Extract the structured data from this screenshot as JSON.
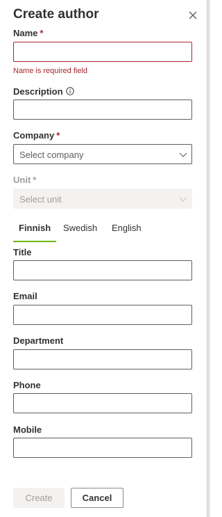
{
  "panel": {
    "title": "Create author"
  },
  "form": {
    "name": {
      "label": "Name",
      "required_mark": "*",
      "value": "",
      "error": "Name is required field"
    },
    "description": {
      "label": "Description",
      "value": ""
    },
    "company": {
      "label": "Company",
      "required_mark": "*",
      "placeholder": "Select company"
    },
    "unit": {
      "label": "Unit",
      "required_mark": "*",
      "placeholder": "Select unit",
      "disabled": true
    },
    "tabs": [
      {
        "label": "Finnish",
        "active": true
      },
      {
        "label": "Swedish",
        "active": false
      },
      {
        "label": "English",
        "active": false
      }
    ],
    "title": {
      "label": "Title",
      "value": ""
    },
    "email": {
      "label": "Email",
      "value": ""
    },
    "department": {
      "label": "Department",
      "value": ""
    },
    "phone": {
      "label": "Phone",
      "value": ""
    },
    "mobile": {
      "label": "Mobile",
      "value": ""
    }
  },
  "actions": {
    "create_label": "Create",
    "cancel_label": "Cancel"
  },
  "icons": {
    "close": "close-icon",
    "info": "info-icon",
    "chevron": "chevron-down-icon"
  },
  "colors": {
    "error": "#a4262c",
    "tab_accent": "#6bb700",
    "text": "#323130",
    "disabled_text": "#a19f9d",
    "disabled_bg": "#f3f2f1"
  }
}
